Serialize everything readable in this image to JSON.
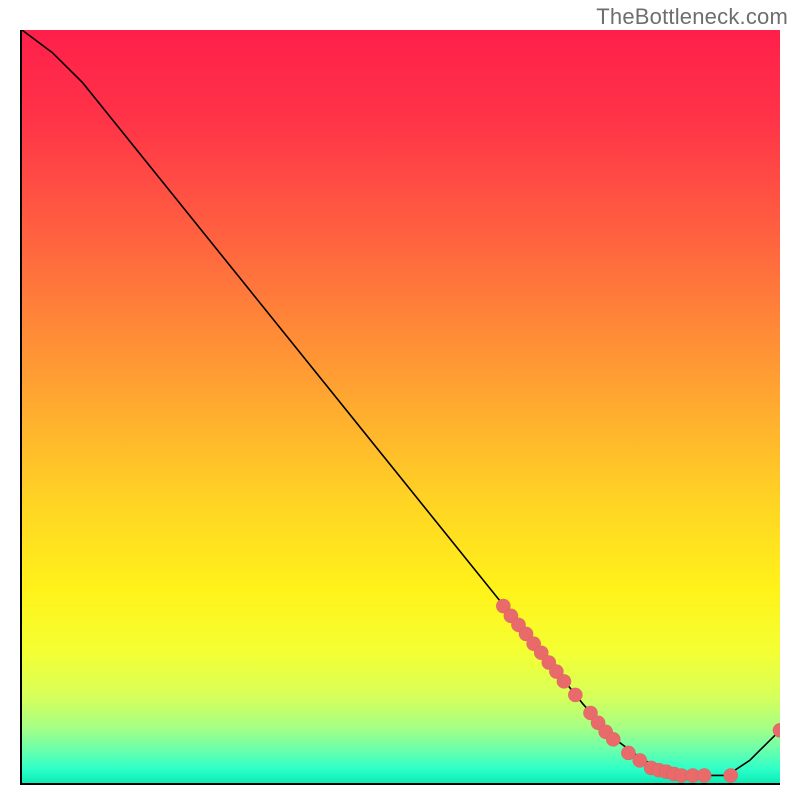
{
  "attribution": "TheBottleneck.com",
  "chart_data": {
    "type": "line",
    "title": "",
    "xlabel": "",
    "ylabel": "",
    "xlim": [
      0,
      100
    ],
    "ylim": [
      0,
      100
    ],
    "grid": false,
    "curve": {
      "x": [
        0,
        4,
        8,
        12,
        20,
        30,
        40,
        50,
        60,
        68,
        74,
        78,
        82,
        86,
        90,
        93,
        96,
        100
      ],
      "y": [
        100,
        97,
        93,
        88,
        78,
        65.5,
        53,
        40.5,
        28,
        18,
        10.5,
        6,
        3,
        1.5,
        1,
        1,
        3,
        7
      ]
    },
    "markers": [
      {
        "x": 63.5,
        "y": 23.5
      },
      {
        "x": 64.5,
        "y": 22.2
      },
      {
        "x": 65.5,
        "y": 21.0
      },
      {
        "x": 66.5,
        "y": 19.8
      },
      {
        "x": 67.5,
        "y": 18.5
      },
      {
        "x": 68.5,
        "y": 17.3
      },
      {
        "x": 69.5,
        "y": 16.0
      },
      {
        "x": 70.5,
        "y": 14.8
      },
      {
        "x": 71.5,
        "y": 13.5
      },
      {
        "x": 73.0,
        "y": 11.7
      },
      {
        "x": 75.0,
        "y": 9.3
      },
      {
        "x": 76.0,
        "y": 8.0
      },
      {
        "x": 77.0,
        "y": 6.8
      },
      {
        "x": 78.0,
        "y": 5.8
      },
      {
        "x": 80.0,
        "y": 4.0
      },
      {
        "x": 81.5,
        "y": 3.0
      },
      {
        "x": 83.0,
        "y": 2.0
      },
      {
        "x": 84.0,
        "y": 1.7
      },
      {
        "x": 85.0,
        "y": 1.5
      },
      {
        "x": 86.0,
        "y": 1.2
      },
      {
        "x": 87.0,
        "y": 1.0
      },
      {
        "x": 88.5,
        "y": 1.0
      },
      {
        "x": 90.0,
        "y": 1.0
      },
      {
        "x": 93.5,
        "y": 1.0
      },
      {
        "x": 100.0,
        "y": 7.0
      }
    ],
    "colors": {
      "marker_fill": "#e86a6a",
      "marker_stroke": "#b24747",
      "line": "#000000",
      "gradient_stops": [
        {
          "pos": 0.0,
          "color": "#ff1f4a"
        },
        {
          "pos": 0.12,
          "color": "#ff3448"
        },
        {
          "pos": 0.3,
          "color": "#ff6a3e"
        },
        {
          "pos": 0.48,
          "color": "#ffa531"
        },
        {
          "pos": 0.62,
          "color": "#ffd324"
        },
        {
          "pos": 0.74,
          "color": "#fff31a"
        },
        {
          "pos": 0.82,
          "color": "#f4ff33"
        },
        {
          "pos": 0.88,
          "color": "#d6ff5a"
        },
        {
          "pos": 0.92,
          "color": "#a6ff84"
        },
        {
          "pos": 0.95,
          "color": "#6affac"
        },
        {
          "pos": 0.975,
          "color": "#2effc8"
        },
        {
          "pos": 1.0,
          "color": "#00e6b0"
        }
      ]
    }
  }
}
